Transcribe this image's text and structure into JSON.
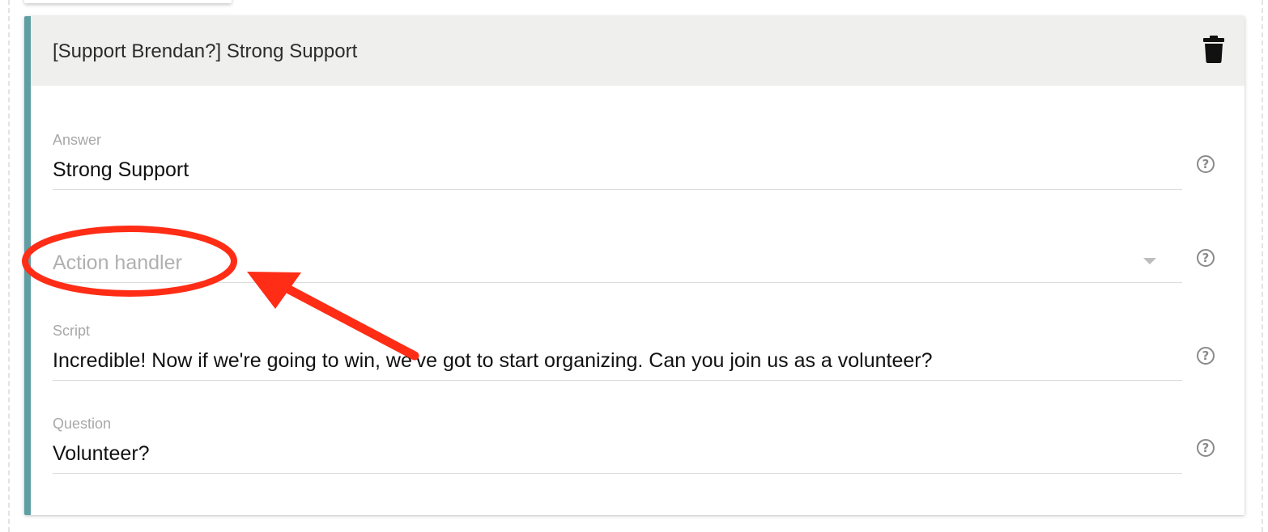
{
  "card": {
    "title": "[Support Brendan?] Strong Support",
    "delete_icon": "trash-icon",
    "accent_color": "#5f9ea3"
  },
  "fields": {
    "answer": {
      "label": "Answer",
      "value": "Strong Support",
      "help_icon": "help-circle-icon"
    },
    "action_handler": {
      "placeholder": "Action handler",
      "dropdown_icon": "caret-down-icon",
      "help_icon": "help-circle-icon"
    },
    "script": {
      "label": "Script",
      "value": "Incredible! Now if we're going to win, we've got to start organizing. Can you join us as a volunteer?",
      "help_icon": "help-circle-icon"
    },
    "question": {
      "label": "Question",
      "value": "Volunteer?",
      "help_icon": "help-circle-icon"
    }
  },
  "annotation": {
    "color": "#ff2d16"
  }
}
